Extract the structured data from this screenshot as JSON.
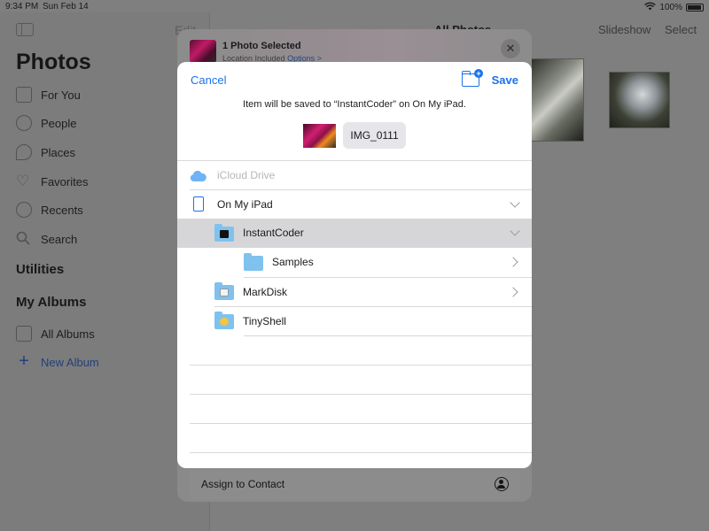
{
  "status_bar": {
    "time": "9:34 PM",
    "date": "Sun Feb 14",
    "battery": "100%"
  },
  "sidebar": {
    "edit_label": "Edit",
    "title": "Photos",
    "items": [
      {
        "label": "For You",
        "icon": "for-you-icon"
      },
      {
        "label": "People",
        "icon": "people-icon"
      },
      {
        "label": "Places",
        "icon": "places-icon"
      },
      {
        "label": "Favorites",
        "icon": "heart-icon"
      },
      {
        "label": "Recents",
        "icon": "clock-icon"
      },
      {
        "label": "Search",
        "icon": "search-icon"
      }
    ],
    "utilities_heading": "Utilities",
    "albums_heading": "My Albums",
    "all_albums": "All Albums",
    "new_album": "New Album"
  },
  "main": {
    "title": "All Photos",
    "slideshow": "Slideshow",
    "select": "Select"
  },
  "share_sheet": {
    "title": "1 Photo Selected",
    "subtitle": "Location Included",
    "options": "Options >",
    "close": "✕",
    "assign_contact": "Assign to Contact"
  },
  "dialog": {
    "cancel": "Cancel",
    "save": "Save",
    "message": "Item will be saved to “InstantCoder” on On My iPad.",
    "file_name": "IMG_0111",
    "locations": [
      {
        "label": "iCloud Drive",
        "state": "disabled"
      },
      {
        "label": "On My iPad",
        "state": "expanded"
      },
      {
        "label": "InstantCoder",
        "state": "selected-expanded"
      },
      {
        "label": "Samples",
        "state": "collapsed"
      },
      {
        "label": "MarkDisk",
        "state": "collapsed"
      },
      {
        "label": "TinyShell",
        "state": "none"
      }
    ]
  },
  "colors": {
    "accent": "#1a73e8",
    "folder": "#7fc2ee",
    "selected_row": "#d6d6d9"
  }
}
